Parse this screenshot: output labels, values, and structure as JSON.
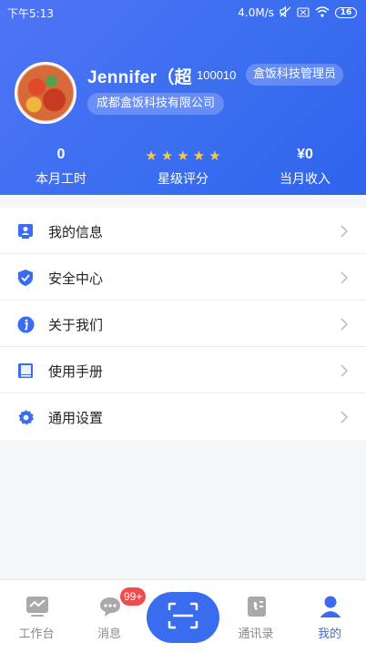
{
  "status_bar": {
    "time": "下午5:13",
    "network_speed": "4.0M/s",
    "battery": "16"
  },
  "profile": {
    "name": "Jennifer（超",
    "user_id": "100010",
    "role": "盒饭科技管理员",
    "company": "成都盒饭科技有限公司"
  },
  "stats": {
    "hours": {
      "value": "0",
      "label": "本月工时"
    },
    "rating": {
      "stars": 5,
      "label": "星级评分",
      "star_color": "#f6c944"
    },
    "income": {
      "value": "¥0",
      "label": "当月收入"
    }
  },
  "menu": {
    "items": [
      {
        "label": "我的信息",
        "icon": "id-card-icon"
      },
      {
        "label": "安全中心",
        "icon": "shield-icon"
      },
      {
        "label": "关于我们",
        "icon": "info-icon"
      },
      {
        "label": "使用手册",
        "icon": "book-icon"
      },
      {
        "label": "通用设置",
        "icon": "gear-icon"
      }
    ]
  },
  "tabbar": {
    "tabs": [
      {
        "label": "工作台",
        "icon": "workbench-icon"
      },
      {
        "label": "消息",
        "icon": "message-icon",
        "badge": "99+"
      },
      {
        "label": "",
        "icon": "scan-icon"
      },
      {
        "label": "通讯录",
        "icon": "contacts-icon"
      },
      {
        "label": "我的",
        "icon": "profile-icon",
        "active": true
      }
    ]
  },
  "colors": {
    "accent": "#3a6cf0",
    "header_gradient_start": "#4f74f5",
    "header_gradient_end": "#2f63ec",
    "badge": "#f04c4c"
  }
}
